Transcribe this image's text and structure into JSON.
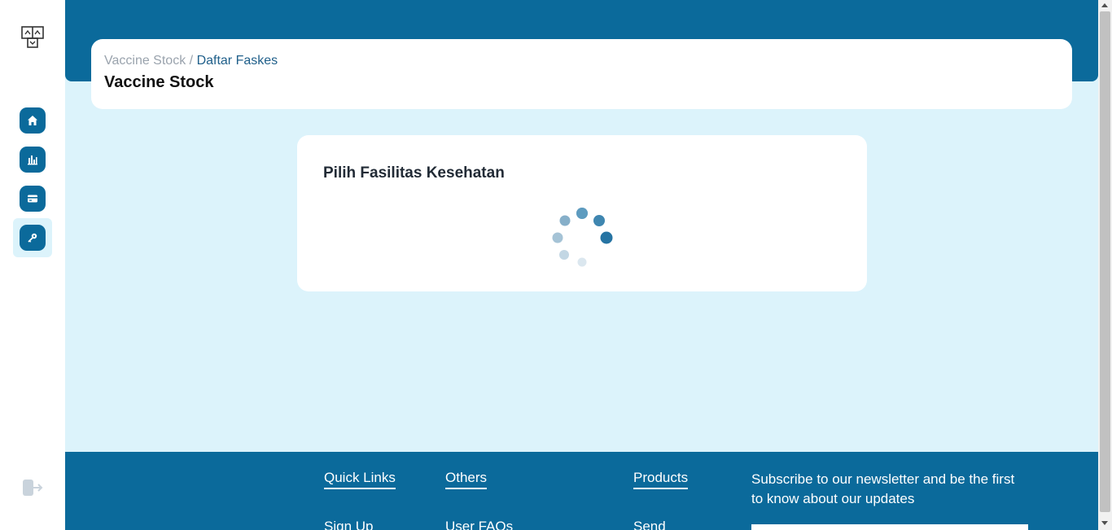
{
  "breadcrumb": {
    "parent": "Vaccine Stock",
    "separator": "/",
    "current": "Daftar Faskes"
  },
  "page_title": "Vaccine Stock",
  "card": {
    "title": "Pilih Fasilitas Kesehatan",
    "loading": true
  },
  "sidebar": {
    "items": [
      {
        "icon": "home-icon"
      },
      {
        "icon": "bar-chart-icon"
      },
      {
        "icon": "card-icon"
      },
      {
        "icon": "key-icon",
        "active": true
      }
    ],
    "logout_icon": "logout-icon"
  },
  "footer": {
    "quick_links": {
      "title": "Quick Links",
      "first_link": "Sign Up"
    },
    "others": {
      "title": "Others",
      "first_link": "User FAQs"
    },
    "products": {
      "title": "Products",
      "first_link": "Send"
    },
    "newsletter_text": "Subscribe to our newsletter and be the first to know about our updates"
  },
  "colors": {
    "primary": "#0b6a9b",
    "background": "#dcf3fb",
    "card": "#ffffff"
  }
}
